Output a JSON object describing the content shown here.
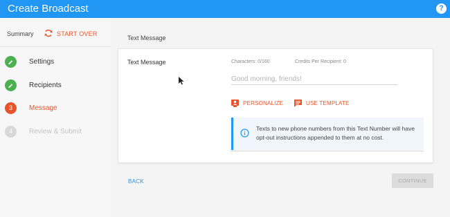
{
  "app": {
    "title": "Create Broadcast",
    "help_icon": "?"
  },
  "sidebar": {
    "summary_label": "Summary",
    "start_over_label": "START OVER",
    "steps": [
      {
        "label": "Settings",
        "status": "done",
        "color": "#4caf50"
      },
      {
        "label": "Recipients",
        "status": "done",
        "color": "#4caf50"
      },
      {
        "number": "3",
        "label": "Message",
        "status": "active",
        "color": "#e8542a"
      },
      {
        "number": "4",
        "label": "Review & Submit",
        "status": "inactive",
        "color": "#d8d8d8"
      }
    ]
  },
  "main": {
    "header": "Text Message",
    "card": {
      "label": "Text Message",
      "characters": "Characters: 0/160",
      "credits": "Credits Per Recipient: 0",
      "input_placeholder": "Good morning, friends!",
      "input_value": "",
      "personalize_label": "PERSONALIZE",
      "use_template_label": "USE TEMPLATE",
      "info_text": "Texts to new phone numbers from this Text Number will have opt-out instructions appended to them at no cost."
    },
    "back_label": "BACK",
    "continue_label": "CONTINUE"
  },
  "colors": {
    "primary": "#2196f3",
    "accent": "#e8542a",
    "success": "#4caf50",
    "disabled": "#dcdcdc"
  }
}
